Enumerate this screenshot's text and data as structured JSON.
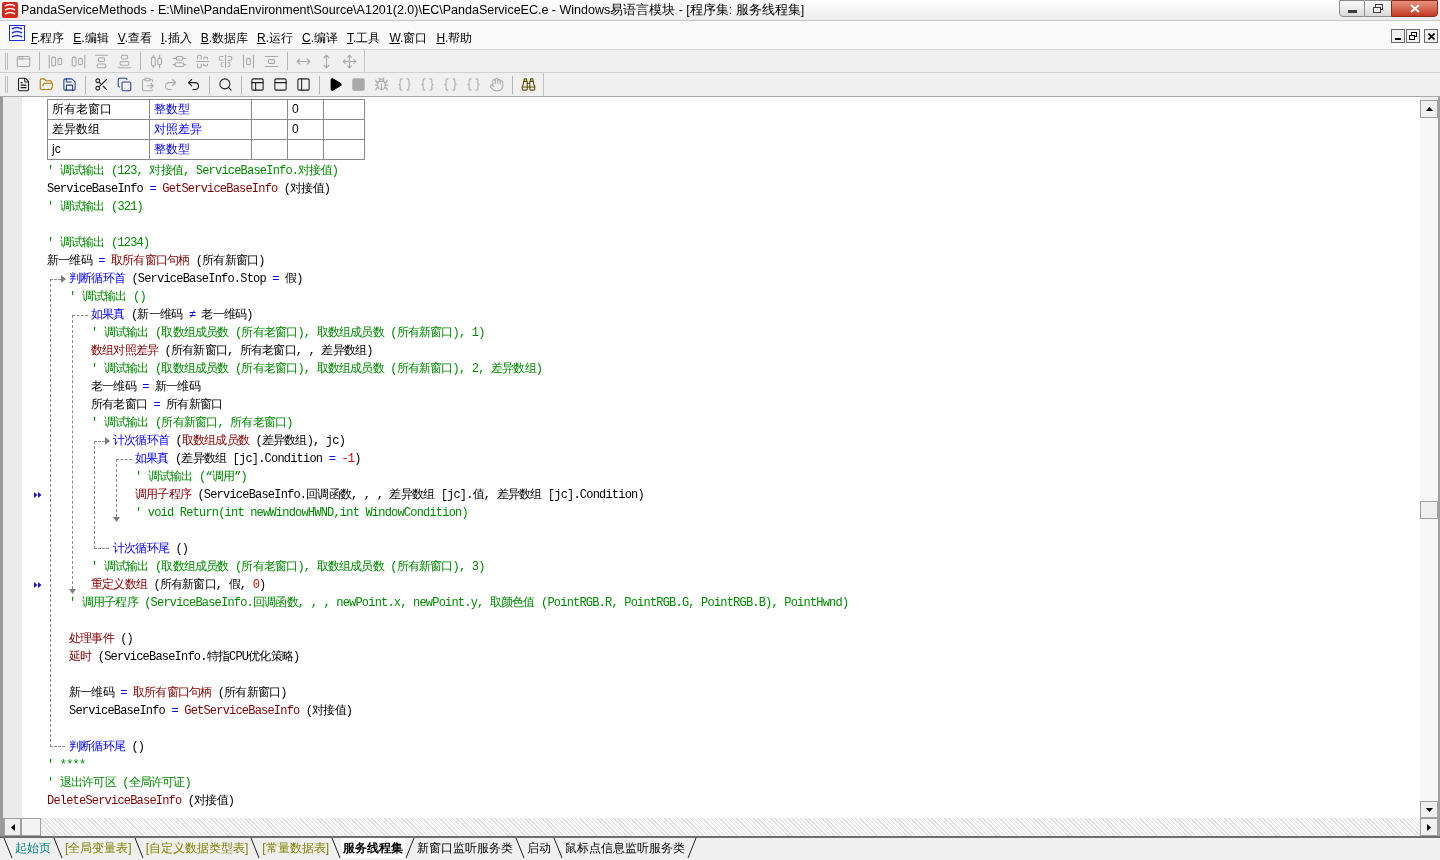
{
  "window": {
    "title": "PandaServiceMethods - E:\\Mine\\PandaEnvironment\\Source\\A1201(2.0)\\EC\\PandaServiceEC.e - Windows易语言模块 - [程序集: 服务线程集]"
  },
  "menu": [
    "F.程序",
    "E.编辑",
    "V.查看",
    "I.插入",
    "B.数据库",
    "R.运行",
    "C.编译",
    "T.工具",
    "W.窗口",
    "H.帮助"
  ],
  "toolbars": [
    {
      "items": [
        {
          "kind": "window",
          "disabled": true
        },
        {
          "kind": "separator"
        },
        {
          "kind": "leftalign",
          "disabled": true
        },
        {
          "kind": "rightalign",
          "disabled": true
        },
        {
          "kind": "topalign",
          "disabled": true
        },
        {
          "kind": "bottomalign",
          "disabled": true
        },
        {
          "kind": "separator"
        },
        {
          "kind": "hdistribute",
          "disabled": true
        },
        {
          "kind": "vdistribute",
          "disabled": true
        },
        {
          "kind": "hcenter",
          "disabled": true
        },
        {
          "kind": "vcenter",
          "disabled": true
        },
        {
          "kind": "hspace",
          "disabled": true
        },
        {
          "kind": "vspace",
          "disabled": true
        },
        {
          "kind": "separator"
        },
        {
          "kind": "hsize",
          "disabled": true
        },
        {
          "kind": "vsize",
          "disabled": true
        },
        {
          "kind": "move",
          "disabled": true
        }
      ]
    },
    {
      "items": [
        {
          "kind": "new",
          "disabled": false
        },
        {
          "kind": "open",
          "disabled": false
        },
        {
          "kind": "save",
          "disabled": false
        },
        {
          "kind": "separator"
        },
        {
          "kind": "cut",
          "disabled": false
        },
        {
          "kind": "copy",
          "disabled": false
        },
        {
          "kind": "paste",
          "disabled": true
        },
        {
          "kind": "redo",
          "disabled": true
        },
        {
          "kind": "undo",
          "disabled": false
        },
        {
          "kind": "separator"
        },
        {
          "kind": "find",
          "disabled": false
        },
        {
          "kind": "separator"
        },
        {
          "kind": "layout",
          "disabled": false
        },
        {
          "kind": "toppanel",
          "disabled": false
        },
        {
          "kind": "sidepanel",
          "disabled": false
        },
        {
          "kind": "separator"
        },
        {
          "kind": "run",
          "disabled": false
        },
        {
          "kind": "stop",
          "disabled": true
        },
        {
          "kind": "debug",
          "disabled": true
        },
        {
          "kind": "stepinto",
          "disabled": true
        },
        {
          "kind": "stepover",
          "disabled": true
        },
        {
          "kind": "stepout",
          "disabled": true
        },
        {
          "kind": "stepto",
          "disabled": true
        },
        {
          "kind": "halt",
          "disabled": true
        },
        {
          "kind": "separator"
        },
        {
          "kind": "help",
          "disabled": false
        }
      ]
    }
  ],
  "variables": [
    {
      "name": "所有老窗口",
      "type": "整数型",
      "column_4": "0"
    },
    {
      "name": "差异数组",
      "type": "对照差异",
      "column_4": "0"
    },
    {
      "name": "jc",
      "type": "整数型"
    }
  ],
  "code": [
    {
      "kind": "comment",
      "text": "' 调试输出 (123, 对接值, ServiceBaseInfo.对接值)",
      "marked": false
    },
    {
      "kind": "code",
      "marked": false,
      "tokens": [
        {
          "kind": "plain",
          "text": "ServiceBaseInfo "
        },
        {
          "kind": "op",
          "text": "= "
        },
        {
          "kind": "cmd",
          "text": "GetServiceBaseInfo"
        },
        {
          "kind": "plain",
          "text": " (对接值)"
        }
      ]
    },
    {
      "kind": "comment",
      "text": "' 调试输出 (321)",
      "marked": false
    },
    {
      "kind": "blank"
    },
    {
      "kind": "comment",
      "text": "' 调试输出 (1234)",
      "marked": false
    },
    {
      "kind": "code",
      "marked": false,
      "tokens": [
        {
          "kind": "plain",
          "text": "新一维码 "
        },
        {
          "kind": "op",
          "text": "= "
        },
        {
          "kind": "cmd",
          "text": "取所有窗口句柄"
        },
        {
          "kind": "plain",
          "text": " (所有新窗口)"
        }
      ]
    },
    {
      "kind": "loop",
      "marked": false,
      "tokens": [
        {
          "kind": "kw",
          "text": "判断循环首"
        },
        {
          "kind": "plain",
          "text": " (ServiceBaseInfo.Stop "
        },
        {
          "kind": "op",
          "text": "= "
        },
        {
          "kind": "plain",
          "text": "假)"
        }
      ],
      "children": [
        {
          "kind": "comment",
          "text": "' 调试输出 ()",
          "marked": false
        },
        {
          "kind": "if",
          "marked": false,
          "tokens": [
            {
              "kind": "kw",
              "text": "如果真"
            },
            {
              "kind": "plain",
              "text": " (新一维码 "
            },
            {
              "kind": "op",
              "text": "≠ "
            },
            {
              "kind": "plain",
              "text": "老一维码)"
            }
          ],
          "children": [
            {
              "kind": "comment",
              "text": "' 调试输出 (取数组成员数 (所有老窗口), 取数组成员数 (所有新窗口), 1)",
              "marked": false
            },
            {
              "kind": "code",
              "marked": false,
              "tokens": [
                {
                  "kind": "cmd",
                  "text": "数组对照差异"
                },
                {
                  "kind": "plain",
                  "text": " (所有新窗口, 所有老窗口, , 差异数组)"
                }
              ]
            },
            {
              "kind": "comment",
              "text": "' 调试输出 (取数组成员数 (所有老窗口), 取数组成员数 (所有新窗口), 2, 差异数组)",
              "marked": false
            },
            {
              "kind": "code",
              "marked": false,
              "tokens": [
                {
                  "kind": "plain",
                  "text": "老一维码 "
                },
                {
                  "kind": "op",
                  "text": "= "
                },
                {
                  "kind": "plain",
                  "text": "新一维码"
                }
              ]
            },
            {
              "kind": "code",
              "marked": false,
              "tokens": [
                {
                  "kind": "plain",
                  "text": "所有老窗口 "
                },
                {
                  "kind": "op",
                  "text": "= "
                },
                {
                  "kind": "plain",
                  "text": "所有新窗口"
                }
              ]
            },
            {
              "kind": "comment",
              "text": "' 调试输出 (所有新窗口, 所有老窗口)",
              "marked": false
            },
            {
              "kind": "loop",
              "marked": false,
              "tokens": [
                {
                  "kind": "kw",
                  "text": "计次循环首"
                },
                {
                  "kind": "plain",
                  "text": " ("
                },
                {
                  "kind": "cmd",
                  "text": "取数组成员数"
                },
                {
                  "kind": "plain",
                  "text": " (差异数组), jc)"
                }
              ],
              "children": [
                {
                  "kind": "if",
                  "marked": false,
                  "tokens": [
                    {
                      "kind": "kw",
                      "text": "如果真"
                    },
                    {
                      "kind": "plain",
                      "text": " (差异数组 [jc].Condition "
                    },
                    {
                      "kind": "op",
                      "text": "= "
                    },
                    {
                      "kind": "num",
                      "text": "-1"
                    },
                    {
                      "kind": "plain",
                      "text": ")"
                    }
                  ],
                  "children": [
                    {
                      "kind": "comment",
                      "text": "' 调试输出 (“调用”)",
                      "marked": false
                    },
                    {
                      "kind": "code",
                      "marked": true,
                      "tokens": [
                        {
                          "kind": "cmd",
                          "text": "调用子程序"
                        },
                        {
                          "kind": "plain",
                          "text": " (ServiceBaseInfo.回调函数, , , 差异数组 [jc].值, 差异数组 [jc].Condition)"
                        }
                      ]
                    },
                    {
                      "kind": "comment",
                      "text": "' void Return(int newWindowHWND,int WindowCondition)",
                      "marked": false
                    }
                  ]
                },
                {
                  "kind": "blank"
                }
              ],
              "end": {
                "marked": false,
                "tokens": [
                  {
                    "kind": "kw",
                    "text": "计次循环尾"
                  },
                  {
                    "kind": "plain",
                    "text": " ()"
                  }
                ]
              }
            },
            {
              "kind": "comment",
              "text": "' 调试输出 (取数组成员数 (所有老窗口), 取数组成员数 (所有新窗口), 3)",
              "marked": false
            },
            {
              "kind": "code",
              "marked": true,
              "tokens": [
                {
                  "kind": "cmd",
                  "text": "重定义数组"
                },
                {
                  "kind": "plain",
                  "text": " (所有新窗口, 假, "
                },
                {
                  "kind": "num",
                  "text": "0"
                },
                {
                  "kind": "plain",
                  "text": ")"
                }
              ]
            }
          ]
        },
        {
          "kind": "comment",
          "text": "' 调用子程序 (ServiceBaseInfo.回调函数, , , newPoint.x, newPoint.y, 取颜色值 (PointRGB.R, PointRGB.G, PointRGB.B), PointHwnd)",
          "marked": false
        },
        {
          "kind": "blank"
        },
        {
          "kind": "code",
          "marked": false,
          "tokens": [
            {
              "kind": "cmd",
              "text": "处理事件"
            },
            {
              "kind": "plain",
              "text": " ()"
            }
          ]
        },
        {
          "kind": "code",
          "marked": false,
          "tokens": [
            {
              "kind": "cmd",
              "text": "延时"
            },
            {
              "kind": "plain",
              "text": " (ServiceBaseInfo.特指CPU优化策略)"
            }
          ]
        },
        {
          "kind": "blank"
        },
        {
          "kind": "code",
          "marked": false,
          "tokens": [
            {
              "kind": "plain",
              "text": "新一维码 "
            },
            {
              "kind": "op",
              "text": "= "
            },
            {
              "kind": "cmd",
              "text": "取所有窗口句柄"
            },
            {
              "kind": "plain",
              "text": " (所有新窗口)"
            }
          ]
        },
        {
          "kind": "code",
          "marked": false,
          "tokens": [
            {
              "kind": "plain",
              "text": "ServiceBaseInfo "
            },
            {
              "kind": "op",
              "text": "= "
            },
            {
              "kind": "cmd",
              "text": "GetServiceBaseInfo"
            },
            {
              "kind": "plain",
              "text": " (对接值)"
            }
          ]
        },
        {
          "kind": "blank"
        }
      ],
      "end": {
        "marked": false,
        "tokens": [
          {
            "kind": "kw",
            "text": "判断循环尾"
          },
          {
            "kind": "plain",
            "text": " ()"
          }
        ]
      }
    },
    {
      "kind": "comment",
      "text": "' ****",
      "marked": false
    },
    {
      "kind": "comment",
      "text": "' 退出许可区 (全局许可证)",
      "marked": false
    },
    {
      "kind": "code",
      "marked": false,
      "tokens": [
        {
          "kind": "cmd",
          "text": "DeleteServiceBaseInfo"
        },
        {
          "kind": "plain",
          "text": " (对接值)"
        }
      ]
    }
  ],
  "tabs": [
    {
      "label": "起始页",
      "kind": "start",
      "selected": false
    },
    {
      "label": "[全局变量表]",
      "kind": "table",
      "selected": false
    },
    {
      "label": "[自定义数据类型表]",
      "kind": "table",
      "selected": false
    },
    {
      "label": "[常量数据表]",
      "kind": "table",
      "selected": false
    },
    {
      "label": "服务线程集",
      "kind": "module",
      "selected": true
    },
    {
      "label": "新窗口监听服务类",
      "kind": "module",
      "selected": false
    },
    {
      "label": "启动",
      "kind": "module",
      "selected": false
    },
    {
      "label": "鼠标点信息监听服务类",
      "kind": "module",
      "selected": false
    }
  ]
}
